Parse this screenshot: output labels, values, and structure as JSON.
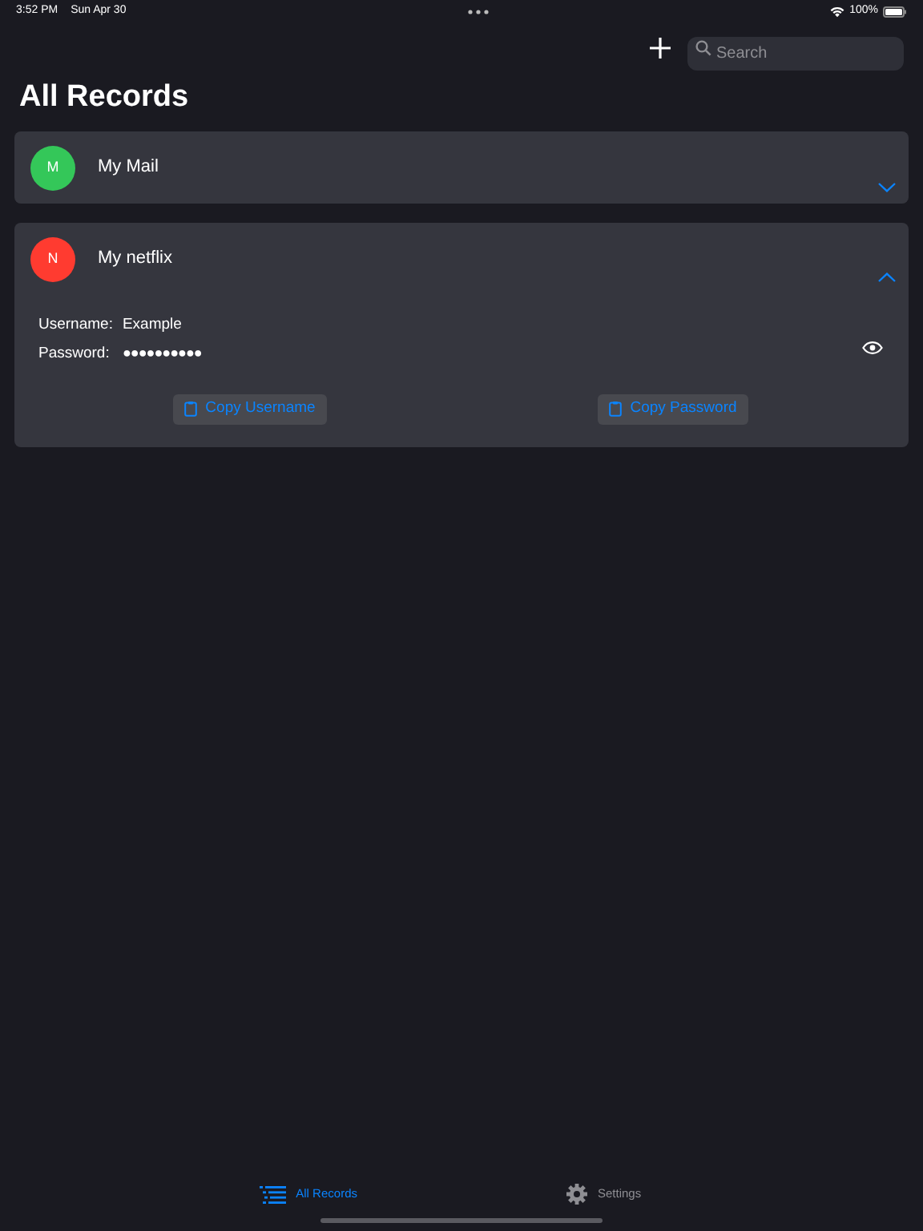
{
  "status_bar": {
    "time": "3:52 PM",
    "date": "Sun Apr 30",
    "battery": "100%"
  },
  "search": {
    "placeholder": "Search"
  },
  "title": "All Records",
  "records": [
    {
      "initial": "M",
      "name": "My Mail",
      "color": "#34c759",
      "expanded": false
    },
    {
      "initial": "N",
      "name": "My netflix",
      "color": "#ff3b30",
      "expanded": true,
      "username_label": "Username:",
      "username": "Example",
      "password_label": "Password:",
      "password": "●●●●●●●●●●",
      "copy_username": "Copy Username",
      "copy_password": "Copy Password"
    }
  ],
  "tabs": [
    {
      "label": "All Records",
      "selected": true,
      "kind": "list"
    },
    {
      "label": "Settings",
      "selected": false,
      "kind": "gear"
    }
  ]
}
